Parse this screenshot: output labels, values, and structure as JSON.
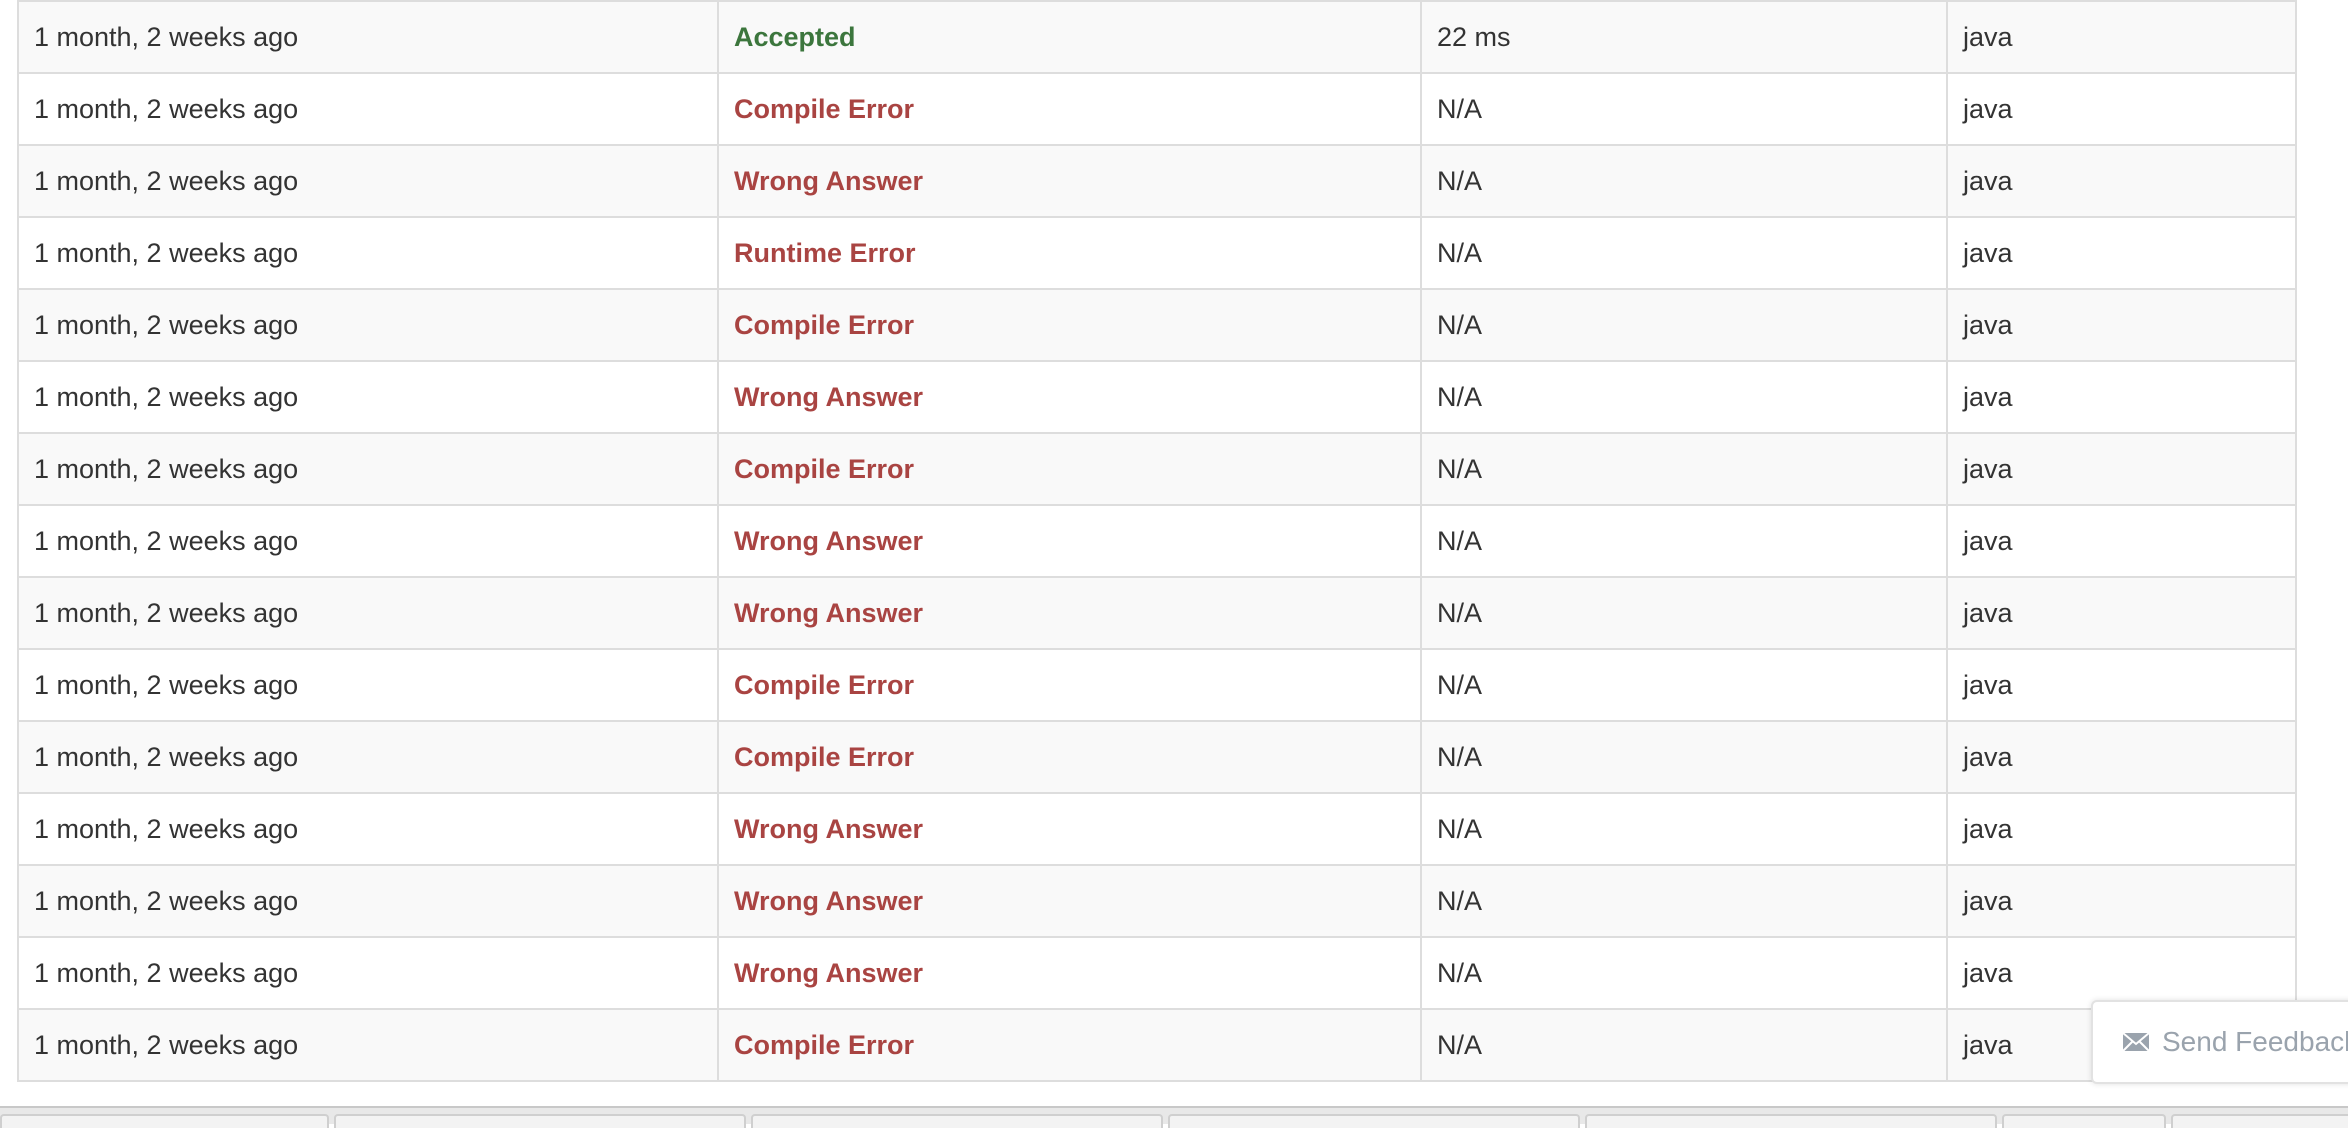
{
  "submissions": [
    {
      "time": "1 month, 2 weeks ago",
      "status": "Accepted",
      "runtime": "22 ms",
      "language": "java",
      "ok": true
    },
    {
      "time": "1 month, 2 weeks ago",
      "status": "Compile Error",
      "runtime": "N/A",
      "language": "java",
      "ok": false
    },
    {
      "time": "1 month, 2 weeks ago",
      "status": "Wrong Answer",
      "runtime": "N/A",
      "language": "java",
      "ok": false
    },
    {
      "time": "1 month, 2 weeks ago",
      "status": "Runtime Error",
      "runtime": "N/A",
      "language": "java",
      "ok": false
    },
    {
      "time": "1 month, 2 weeks ago",
      "status": "Compile Error",
      "runtime": "N/A",
      "language": "java",
      "ok": false
    },
    {
      "time": "1 month, 2 weeks ago",
      "status": "Wrong Answer",
      "runtime": "N/A",
      "language": "java",
      "ok": false
    },
    {
      "time": "1 month, 2 weeks ago",
      "status": "Compile Error",
      "runtime": "N/A",
      "language": "java",
      "ok": false
    },
    {
      "time": "1 month, 2 weeks ago",
      "status": "Wrong Answer",
      "runtime": "N/A",
      "language": "java",
      "ok": false
    },
    {
      "time": "1 month, 2 weeks ago",
      "status": "Wrong Answer",
      "runtime": "N/A",
      "language": "java",
      "ok": false
    },
    {
      "time": "1 month, 2 weeks ago",
      "status": "Compile Error",
      "runtime": "N/A",
      "language": "java",
      "ok": false
    },
    {
      "time": "1 month, 2 weeks ago",
      "status": "Compile Error",
      "runtime": "N/A",
      "language": "java",
      "ok": false
    },
    {
      "time": "1 month, 2 weeks ago",
      "status": "Wrong Answer",
      "runtime": "N/A",
      "language": "java",
      "ok": false
    },
    {
      "time": "1 month, 2 weeks ago",
      "status": "Wrong Answer",
      "runtime": "N/A",
      "language": "java",
      "ok": false
    },
    {
      "time": "1 month, 2 weeks ago",
      "status": "Wrong Answer",
      "runtime": "N/A",
      "language": "java",
      "ok": false
    },
    {
      "time": "1 month, 2 weeks ago",
      "status": "Compile Error",
      "runtime": "N/A",
      "language": "java",
      "ok": false
    }
  ],
  "feedback": {
    "label": "Send Feedback",
    "icon": "envelope-icon"
  },
  "colors": {
    "accepted": "#3c763d",
    "error": "#a94442",
    "stripe": "#f9f9f9",
    "border": "#dddddd",
    "feedback_text": "#9aa3ad"
  }
}
